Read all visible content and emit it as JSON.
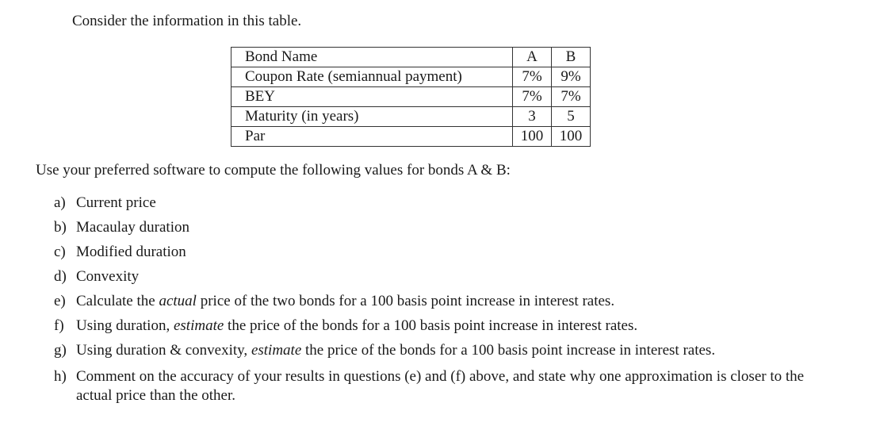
{
  "intro": "Consider the information in this table.",
  "table": {
    "headers": [
      "Bond Name",
      "A",
      "B"
    ],
    "rows": [
      {
        "label": "Coupon Rate (semiannual payment)",
        "a": "7%",
        "b": "9%"
      },
      {
        "label": "BEY",
        "a": "7%",
        "b": "7%"
      },
      {
        "label": "Maturity (in years)",
        "a": "3",
        "b": "5"
      },
      {
        "label": "Par",
        "a": "100",
        "b": "100"
      }
    ]
  },
  "lead": "Use your preferred software to compute the following values for bonds A & B:",
  "questions": [
    {
      "letter": "a)",
      "pre": "Current price",
      "em": "",
      "post": ""
    },
    {
      "letter": "b)",
      "pre": "Macaulay duration",
      "em": "",
      "post": ""
    },
    {
      "letter": "c)",
      "pre": "Modified duration",
      "em": "",
      "post": ""
    },
    {
      "letter": "d)",
      "pre": "Convexity",
      "em": "",
      "post": ""
    },
    {
      "letter": "e)",
      "pre": "Calculate the ",
      "em": "actual",
      "post": " price of the two bonds for a 100 basis point increase in interest rates."
    },
    {
      "letter": "f)",
      "pre": "Using duration, ",
      "em": "estimate",
      "post": " the price of the bonds for a 100 basis point increase in interest rates."
    },
    {
      "letter": "g)",
      "pre": "Using duration & convexity, ",
      "em": "estimate",
      "post": " the price of the bonds for a 100 basis point increase in interest rates."
    },
    {
      "letter": "h)",
      "pre": "Comment on the accuracy of your results in questions (e) and (f) above, and state why one approximation is closer to the actual price than the other.",
      "em": "",
      "post": ""
    }
  ]
}
